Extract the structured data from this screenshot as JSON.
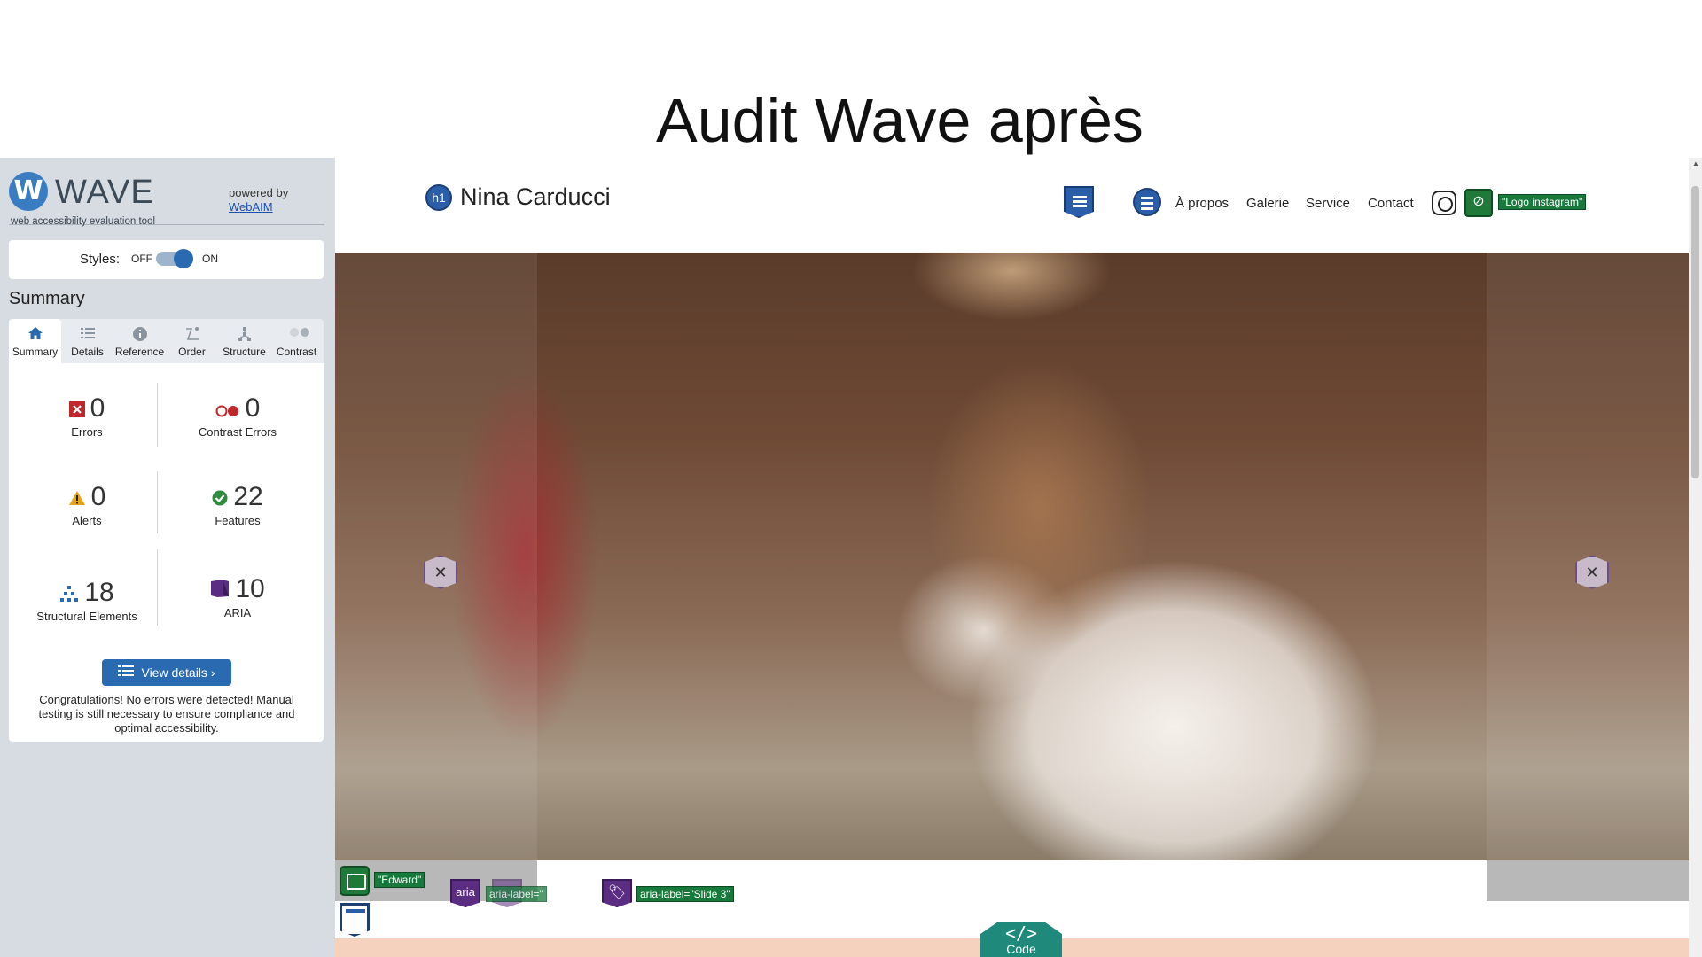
{
  "slide": {
    "title": "Audit Wave après"
  },
  "wave": {
    "logo_letter": "W",
    "name": "WAVE",
    "tagline": "web accessibility evaluation tool",
    "powered_by": "powered by",
    "webaim_link": "WebAIM",
    "styles_label": "Styles:",
    "styles_off": "OFF",
    "styles_on": "ON",
    "styles_enabled": true,
    "summary_title": "Summary",
    "tabs": [
      {
        "label": "Summary",
        "icon": "home-icon",
        "active": true
      },
      {
        "label": "Details",
        "icon": "list-icon"
      },
      {
        "label": "Reference",
        "icon": "info-icon"
      },
      {
        "label": "Order",
        "icon": "order-icon"
      },
      {
        "label": "Structure",
        "icon": "structure-icon"
      },
      {
        "label": "Contrast",
        "icon": "contrast-icon"
      }
    ],
    "stats": {
      "errors": {
        "value": "0",
        "label": "Errors",
        "color": "#c0272d"
      },
      "contrast_errors": {
        "value": "0",
        "label": "Contrast Errors",
        "color": "#c0272d"
      },
      "alerts": {
        "value": "0",
        "label": "Alerts",
        "color": "#e8a317"
      },
      "features": {
        "value": "22",
        "label": "Features",
        "color": "#2e8b3e"
      },
      "structural": {
        "value": "18",
        "label": "Structural Elements",
        "color": "#2a6ab0"
      },
      "aria": {
        "value": "10",
        "label": "ARIA",
        "color": "#5a2c82"
      }
    },
    "view_details": "View details ›",
    "congrats": "Congratulations! No errors were detected! Manual testing is still necessary to ensure compliance and optimal accessibility."
  },
  "site": {
    "h1_badge": "h1",
    "name": "Nina Carducci",
    "nav": [
      "À propos",
      "Galerie",
      "Service",
      "Contact"
    ],
    "insta_alt_label": "\"Logo instagram\"",
    "edward_label": "\"Edward\"",
    "aria_badge": "aria",
    "aria_label_overlap": "aria-label=\"",
    "aria_label_slide3": "aria-label=\"Slide 3\"",
    "code_button": "Code",
    "code_symbol": "</>"
  },
  "colors": {
    "wave_sidebar_bg": "#d6dce2",
    "wave_blue": "#2a6ab0",
    "feature_green": "#177a3c",
    "aria_purple": "#5a2c82",
    "code_teal": "#1f8a7c",
    "footer_peach": "#f4d2bd"
  }
}
